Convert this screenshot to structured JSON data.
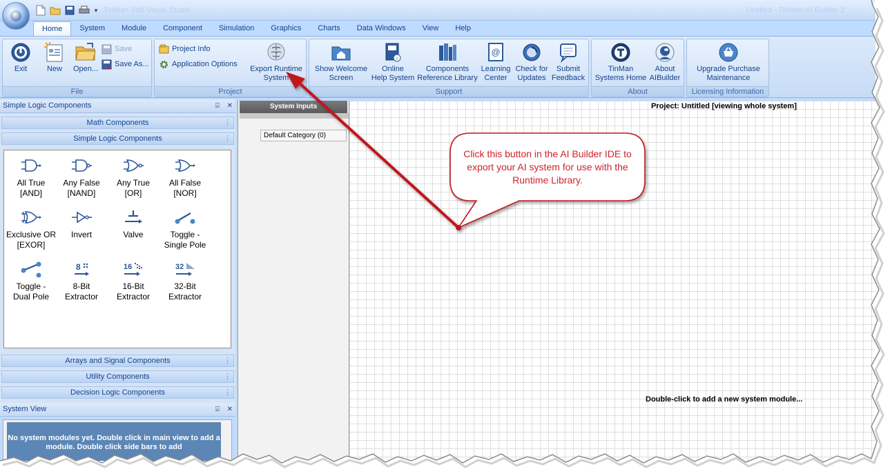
{
  "window": {
    "title_ghost": "TinMan Soft Visual Studio",
    "app_title": "Untitled - TinMan AI Builder 2"
  },
  "tabs": [
    {
      "label": "Home",
      "active": true
    },
    {
      "label": "System"
    },
    {
      "label": "Module"
    },
    {
      "label": "Component"
    },
    {
      "label": "Simulation"
    },
    {
      "label": "Graphics"
    },
    {
      "label": "Charts"
    },
    {
      "label": "Data Windows"
    },
    {
      "label": "View"
    },
    {
      "label": "Help"
    }
  ],
  "ribbon": {
    "file": {
      "label": "File",
      "exit": "Exit",
      "new": "New",
      "open": "Open...",
      "save": "Save",
      "save_as": "Save As..."
    },
    "project": {
      "label": "Project",
      "project_info": "Project Info",
      "application_options": "Application Options",
      "export_line1": "Export Runtime",
      "export_line2": "System"
    },
    "support": {
      "label": "Support",
      "welcome_line1": "Show Welcome",
      "welcome_line2": "Screen",
      "help_line1": "Online",
      "help_line2": "Help System",
      "ref_line1": "Components",
      "ref_line2": "Reference Library",
      "learning_line1": "Learning",
      "learning_line2": "Center",
      "updates_line1": "Check for",
      "updates_line2": "Updates",
      "feedback_line1": "Submit",
      "feedback_line2": "Feedback"
    },
    "about": {
      "label": "About",
      "tinman_line1": "TinMan",
      "tinman_line2": "Systems Home",
      "about_line1": "About",
      "about_line2": "AIBuilder"
    },
    "licensing": {
      "label": "Licensing Information",
      "upgrade_line1": "Upgrade Purchase",
      "upgrade_line2": "Maintenance"
    }
  },
  "toolbox": {
    "title": "Simple Logic Components",
    "pin": "⍄",
    "close": "✕",
    "categories_top": [
      "Math Components",
      "Simple Logic Components"
    ],
    "categories_bottom": [
      "Arrays and Signal Components",
      "Utility Components",
      "Decision Logic Components"
    ],
    "components": [
      {
        "line1": "All True",
        "line2": "[AND]",
        "icon": "and-gate-icon"
      },
      {
        "line1": "Any False",
        "line2": "[NAND]",
        "icon": "nand-gate-icon"
      },
      {
        "line1": "Any True",
        "line2": "[OR]",
        "icon": "or-gate-icon"
      },
      {
        "line1": "All False",
        "line2": "[NOR]",
        "icon": "nor-gate-icon"
      },
      {
        "line1": "Exclusive OR",
        "line2": "[EXOR]",
        "icon": "xor-gate-icon"
      },
      {
        "line1": "Invert",
        "line2": "",
        "icon": "invert-icon"
      },
      {
        "line1": "Valve",
        "line2": "",
        "icon": "valve-icon"
      },
      {
        "line1": "Toggle -",
        "line2": "Single Pole",
        "icon": "toggle-single-icon"
      },
      {
        "line1": "Toggle -",
        "line2": "Dual Pole",
        "icon": "toggle-dual-icon"
      },
      {
        "line1": "8-Bit",
        "line2": "Extractor",
        "icon": "8bit-icon",
        "badge": "8"
      },
      {
        "line1": "16-Bit",
        "line2": "Extractor",
        "icon": "16bit-icon",
        "badge": "16"
      },
      {
        "line1": "32-Bit",
        "line2": "Extractor",
        "icon": "32bit-icon",
        "badge": "32"
      }
    ]
  },
  "system_view": {
    "title": "System View",
    "message": "No system modules yet. Double click in main view to add a module. Double click side bars to add"
  },
  "system_inputs": {
    "title": "System Inputs",
    "default_category": "Default Category (0)"
  },
  "canvas": {
    "project_label": "Project: Untitled [viewing whole system]",
    "hint": "Double-click to add a new system module..."
  },
  "callout": {
    "text": "Click this button in the AI Builder IDE to export your AI system for use with the Runtime Library.",
    "color": "#d0212a"
  },
  "colors": {
    "ribbon_text": "#15428b",
    "ribbon_bg": "#bfdbff",
    "accent_red": "#c1121b"
  }
}
